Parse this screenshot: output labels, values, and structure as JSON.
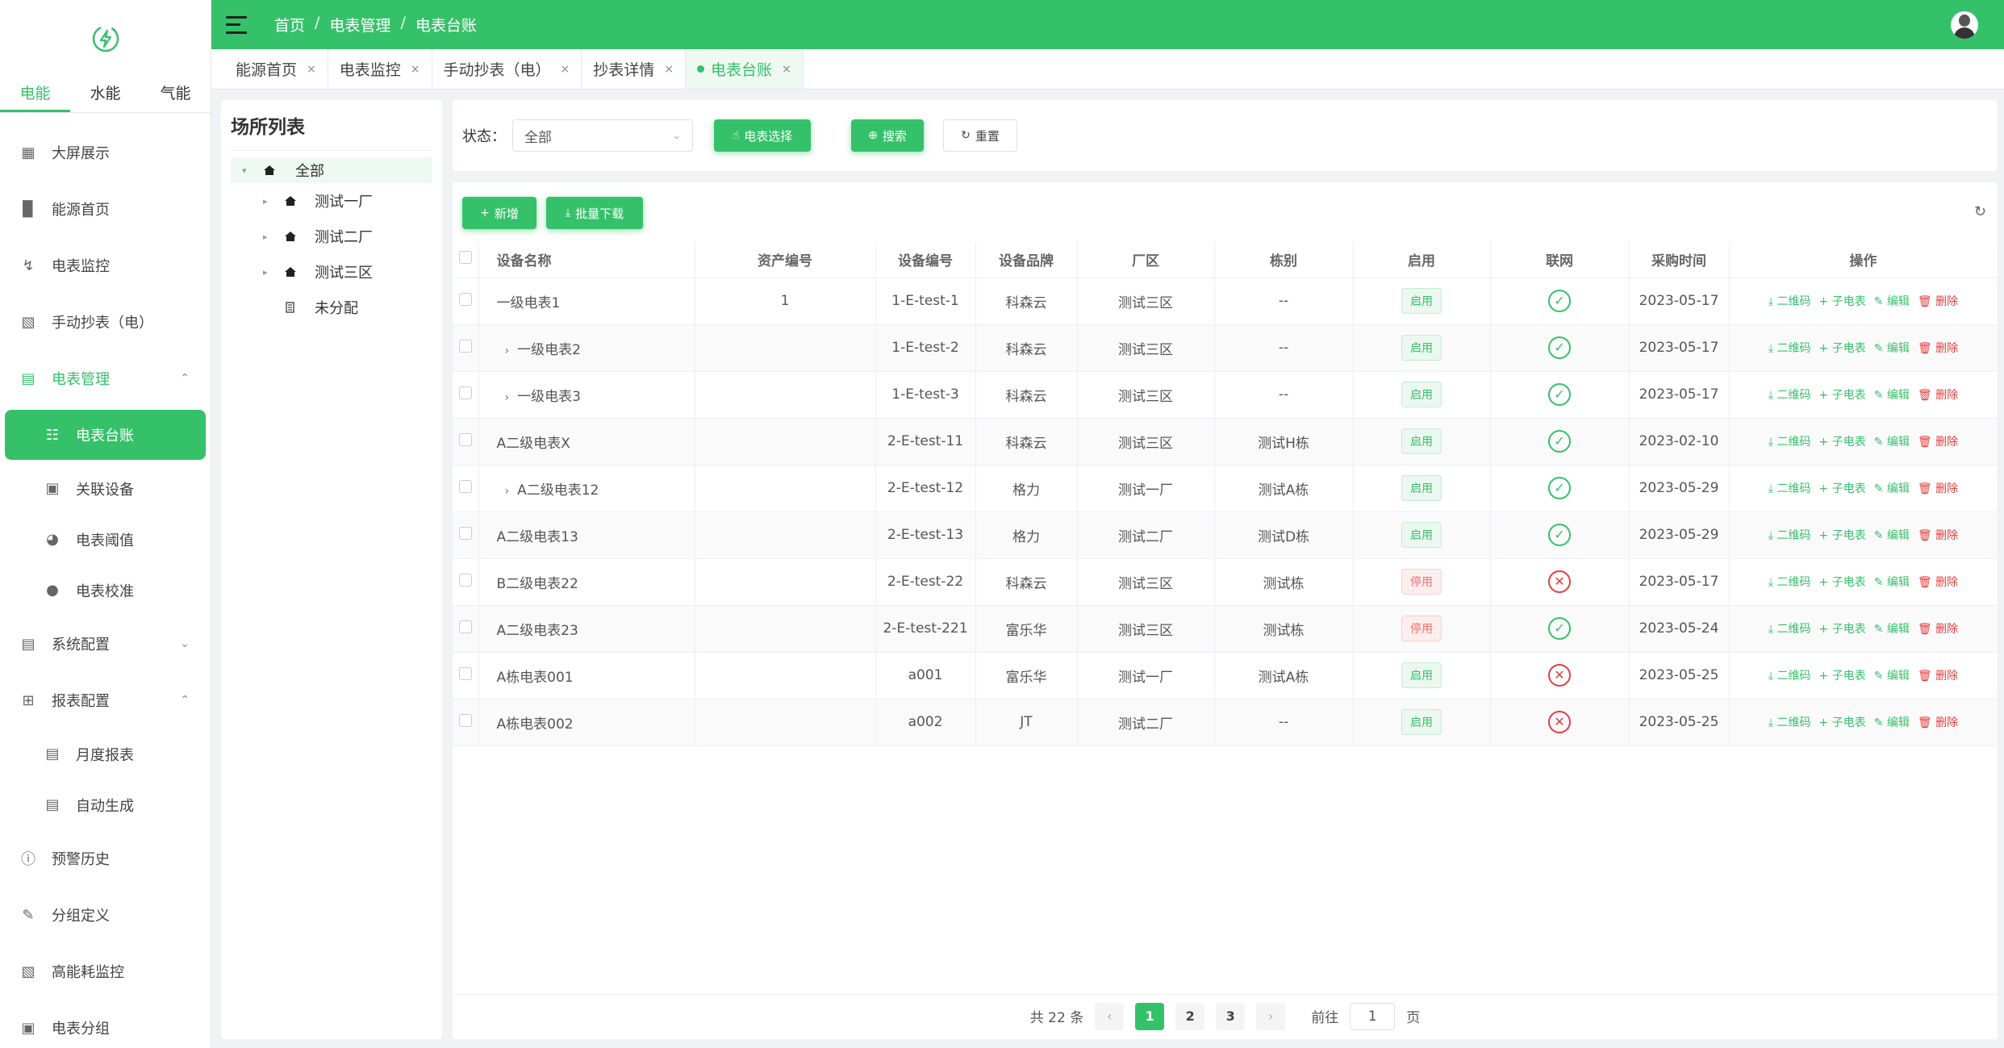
{
  "sidebar": {
    "energy_tabs": [
      "电能",
      "水能",
      "气能"
    ],
    "menu": [
      {
        "label": "大屏展示",
        "icon": "presentation-icon"
      },
      {
        "label": "能源首页",
        "icon": "bar-chart-icon"
      },
      {
        "label": "电表监控",
        "icon": "lightning-icon"
      },
      {
        "label": "手动抄表（电）",
        "icon": "keyboard-icon"
      },
      {
        "label": "电表管理",
        "icon": "meter-doc-icon"
      },
      {
        "label": "电表台账",
        "icon": "hierarchy-icon"
      },
      {
        "label": "关联设备",
        "icon": "wallet-icon"
      },
      {
        "label": "电表阈值",
        "icon": "dial-icon"
      },
      {
        "label": "电表校准",
        "icon": "user-icon"
      },
      {
        "label": "系统配置",
        "icon": "settings-doc-icon"
      },
      {
        "label": "报表配置",
        "icon": "doc-plus-icon"
      },
      {
        "label": "月度报表",
        "icon": "list-doc-icon"
      },
      {
        "label": "自动生成",
        "icon": "doc-icon"
      },
      {
        "label": "预警历史",
        "icon": "warning-circle-icon"
      },
      {
        "label": "分组定义",
        "icon": "edit-icon"
      },
      {
        "label": "高能耗监控",
        "icon": "monitor-chart-icon"
      },
      {
        "label": "电表分组",
        "icon": "box-icon"
      }
    ]
  },
  "header": {
    "breadcrumb": [
      "首页",
      "电表管理",
      "电表台账"
    ],
    "separator": "/"
  },
  "page_tabs": [
    {
      "label": "能源首页"
    },
    {
      "label": "电表监控"
    },
    {
      "label": "手动抄表（电）"
    },
    {
      "label": "抄表详情"
    },
    {
      "label": "电表台账"
    }
  ],
  "tab_close": "×",
  "tree": {
    "title": "场所列表",
    "root": "全部",
    "items": [
      "测试一厂",
      "测试二厂",
      "测试三区",
      "未分配"
    ]
  },
  "search": {
    "status_label": "状态：",
    "status_value": "全部",
    "meter_select_btn": "电表选择",
    "search_btn": "搜索",
    "reset_btn": "重置"
  },
  "toolbar": {
    "add_btn": "新增",
    "batch_download_btn": "批量下载"
  },
  "table": {
    "headers": [
      "设备名称",
      "资产编号",
      "设备编号",
      "设备品牌",
      "厂区",
      "栋别",
      "启用",
      "联网",
      "采购时间",
      "操作"
    ],
    "rows": [
      {
        "name": "一级电表1",
        "asset": "1",
        "code": "1-E-test-1",
        "brand": "科森云",
        "zone": "测试三区",
        "building": "--",
        "enabled": "启用",
        "online": true,
        "date": "2023-05-17"
      },
      {
        "name": "一级电表2",
        "asset": "",
        "code": "1-E-test-2",
        "brand": "科森云",
        "zone": "测试三区",
        "building": "--",
        "enabled": "启用",
        "online": true,
        "date": "2023-05-17"
      },
      {
        "name": "一级电表3",
        "asset": "",
        "code": "1-E-test-3",
        "brand": "科森云",
        "zone": "测试三区",
        "building": "--",
        "enabled": "启用",
        "online": true,
        "date": "2023-05-17"
      },
      {
        "name": "A二级电表X",
        "asset": "",
        "code": "2-E-test-11",
        "brand": "科森云",
        "zone": "测试三区",
        "building": "测试H栋",
        "enabled": "启用",
        "online": true,
        "date": "2023-02-10"
      },
      {
        "name": "A二级电表12",
        "asset": "",
        "code": "2-E-test-12",
        "brand": "格力",
        "zone": "测试一厂",
        "building": "测试A栋",
        "enabled": "启用",
        "online": true,
        "date": "2023-05-29"
      },
      {
        "name": "A二级电表13",
        "asset": "",
        "code": "2-E-test-13",
        "brand": "格力",
        "zone": "测试二厂",
        "building": "测试D栋",
        "enabled": "启用",
        "online": true,
        "date": "2023-05-29"
      },
      {
        "name": "B二级电表22",
        "asset": "",
        "code": "2-E-test-22",
        "brand": "科森云",
        "zone": "测试三区",
        "building": "测试栋",
        "enabled": "停用",
        "online": false,
        "date": "2023-05-17"
      },
      {
        "name": "A二级电表23",
        "asset": "",
        "code": "2-E-test-221",
        "brand": "富乐华",
        "zone": "测试三区",
        "building": "测试栋",
        "enabled": "停用",
        "online": true,
        "date": "2023-05-24"
      },
      {
        "name": "A栋电表001",
        "asset": "",
        "code": "a001",
        "brand": "富乐华",
        "zone": "测试一厂",
        "building": "测试A栋",
        "enabled": "启用",
        "online": false,
        "date": "2023-05-25"
      },
      {
        "name": "A栋电表002",
        "asset": "",
        "code": "a002",
        "brand": "JT",
        "zone": "测试二厂",
        "building": "--",
        "enabled": "启用",
        "online": false,
        "date": "2023-05-25"
      }
    ],
    "expandable": [
      false,
      true,
      true,
      false,
      true,
      false,
      false,
      false,
      false,
      false
    ],
    "actions": [
      "二维码",
      "子电表",
      "编辑",
      "删除"
    ]
  },
  "pagination": {
    "total": "共 22 条",
    "pages": [
      "1",
      "2",
      "3"
    ],
    "current": "1",
    "goto_label": "前往",
    "goto_value": "1",
    "page_unit": "页"
  },
  "colors": {
    "accent": "#35c16a",
    "danger": "#e53e3e"
  }
}
